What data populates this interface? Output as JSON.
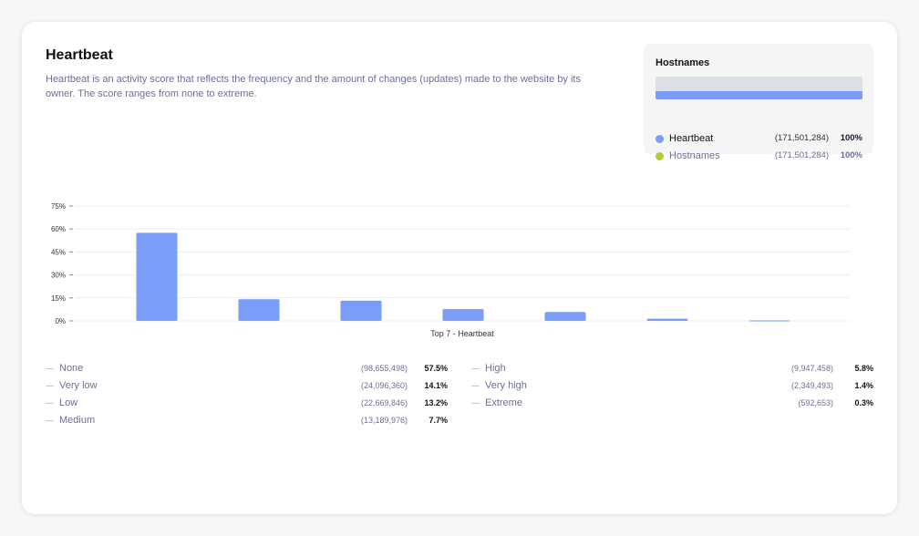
{
  "header": {
    "title": "Heartbeat",
    "description": "Heartbeat is an activity score that reflects the frequency and the amount of changes (updates) made to the website by its owner. The score ranges from none to extreme."
  },
  "hostnames_panel": {
    "title": "Hostnames",
    "bar_fill": 1.0,
    "rows": [
      {
        "name": "Heartbeat",
        "count": "(171,501,284)",
        "pct": "100%",
        "color": "#7b9cf7"
      },
      {
        "name": "Hostnames",
        "count": "(171,501,284)",
        "pct": "100%",
        "color": "#b5c934"
      }
    ]
  },
  "chart_data": {
    "type": "bar",
    "categories": [
      "None",
      "Very low",
      "Low",
      "Medium",
      "High",
      "Very high",
      "Extreme"
    ],
    "values": [
      57.5,
      14.1,
      13.2,
      7.7,
      5.8,
      1.4,
      0.3
    ],
    "xlabel": "Top 7 - Heartbeat",
    "ylabel": "",
    "ylim": [
      0,
      75
    ],
    "yticks": [
      "0%",
      "15%",
      "30%",
      "45%",
      "60%",
      "75%"
    ],
    "ytick_values": [
      0,
      15,
      30,
      45,
      60,
      75
    ],
    "grid": true,
    "bar_color": "#7b9cf7"
  },
  "legend": [
    {
      "name": "None",
      "count": "(98,655,498)",
      "pct": "57.5%"
    },
    {
      "name": "Very low",
      "count": "(24,096,360)",
      "pct": "14.1%"
    },
    {
      "name": "Low",
      "count": "(22,669,846)",
      "pct": "13.2%"
    },
    {
      "name": "Medium",
      "count": "(13,189,976)",
      "pct": "7.7%"
    },
    {
      "name": "High",
      "count": "(9,947,458)",
      "pct": "5.8%"
    },
    {
      "name": "Very high",
      "count": "(2,349,493)",
      "pct": "1.4%"
    },
    {
      "name": "Extreme",
      "count": "(592,653)",
      "pct": "0.3%"
    }
  ]
}
